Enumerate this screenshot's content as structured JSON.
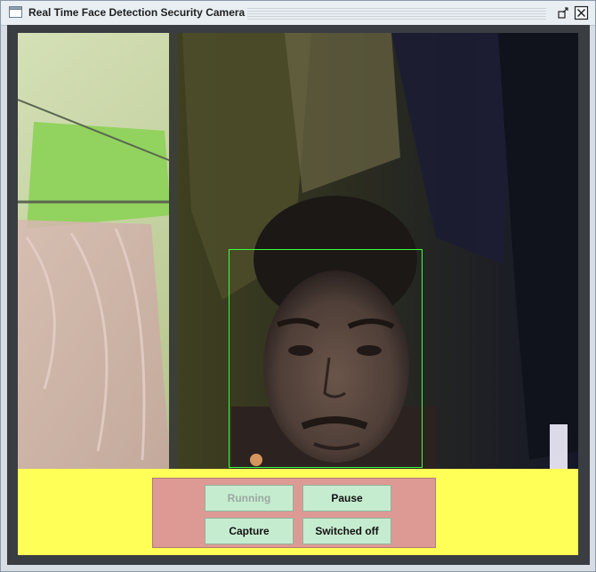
{
  "window": {
    "title": "Real Time Face Detection Security Camera",
    "icons": [
      "window-app-icon",
      "restore-icon",
      "close-icon"
    ]
  },
  "camera": {
    "feed_name": "live-camera-feed",
    "detection_box_color": "#3cff3c"
  },
  "controls": {
    "running_label": "Running",
    "pause_label": "Pause",
    "capture_label": "Capture",
    "switched_off_label": "Switched off"
  },
  "colors": {
    "control_area": "#ffff58",
    "control_panel": "#dd9a94",
    "button": "#c6ecd0"
  }
}
